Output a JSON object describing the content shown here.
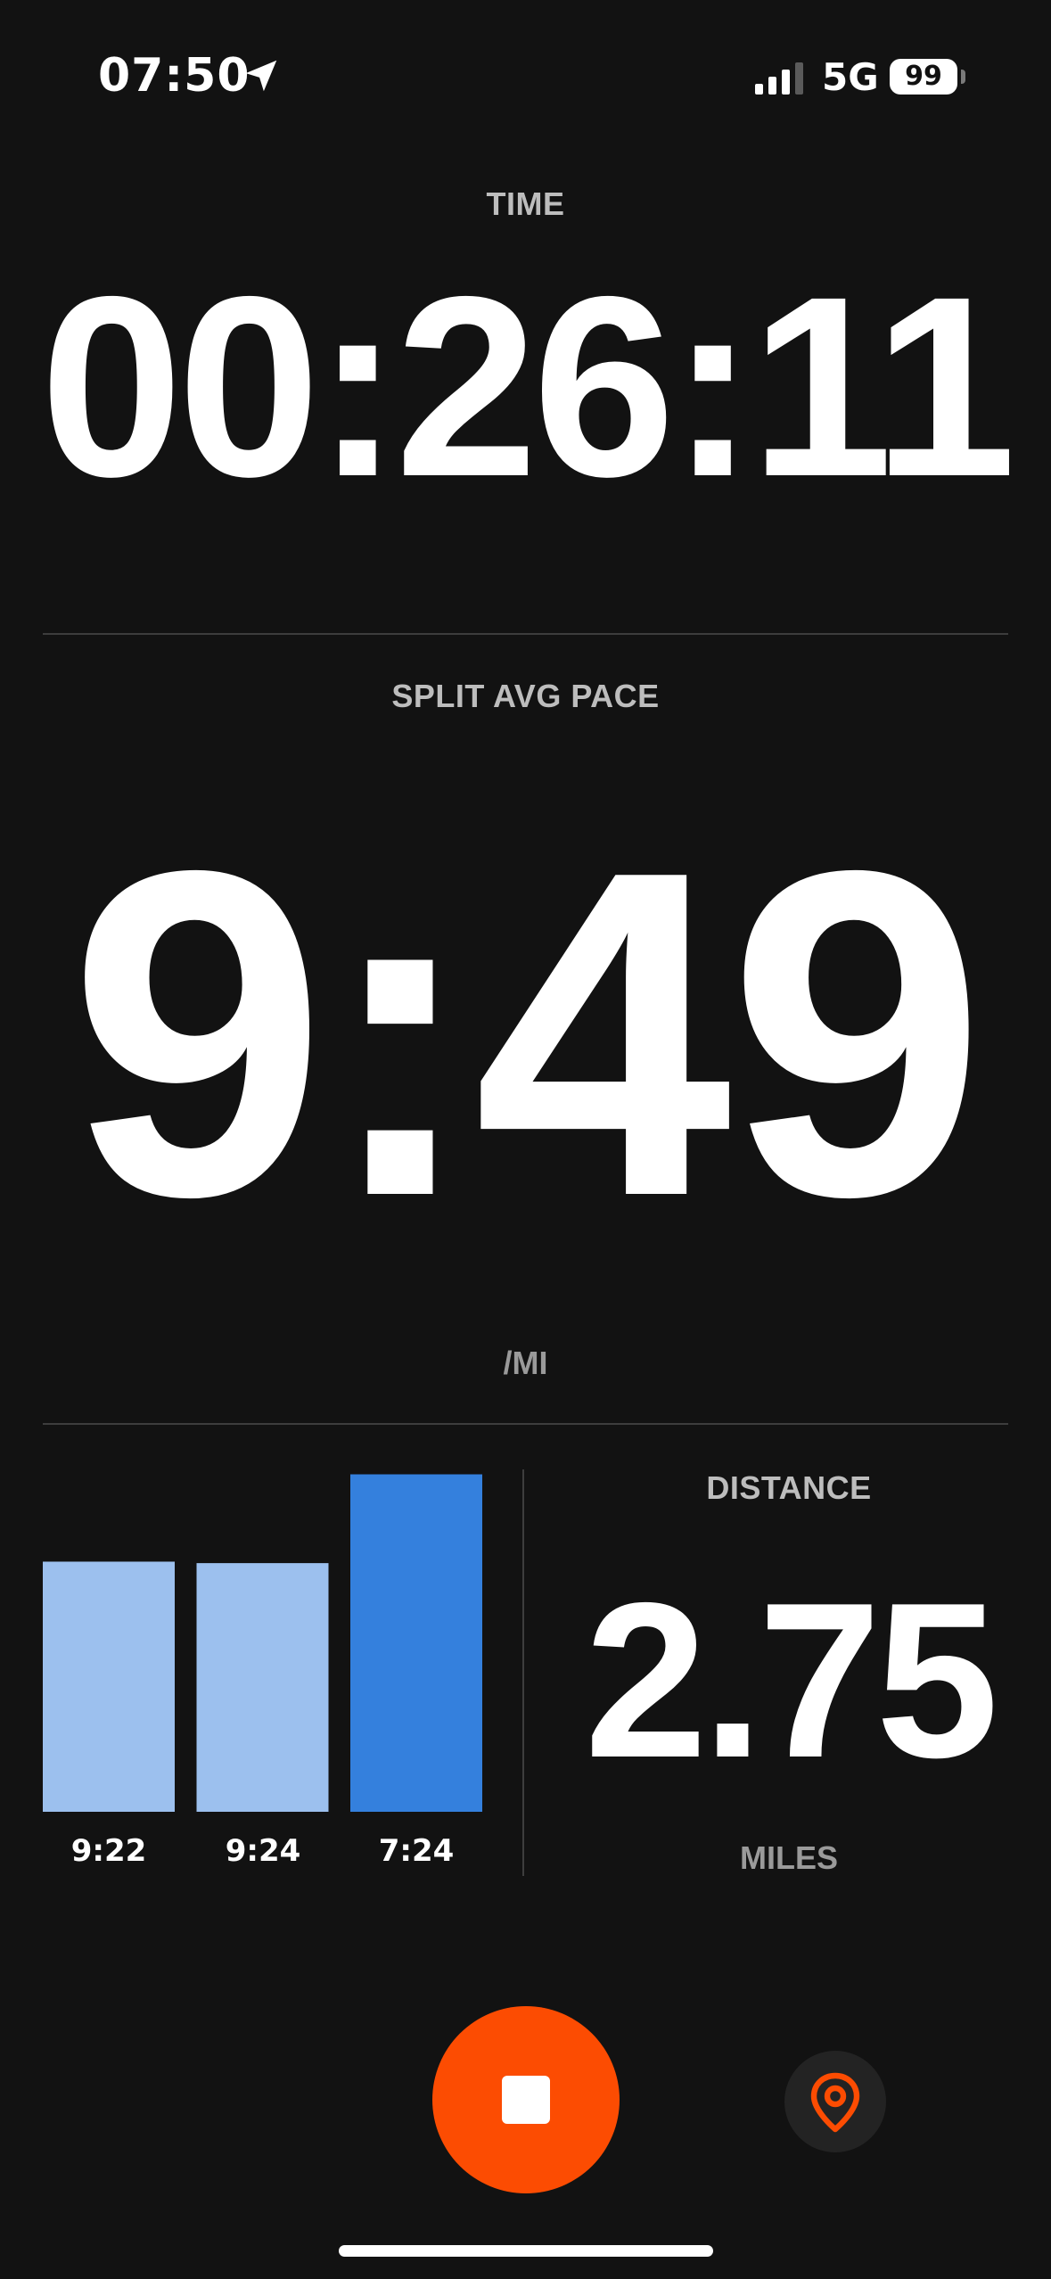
{
  "status_bar": {
    "time": "07:50",
    "network": "5G",
    "battery": "99",
    "icons": [
      "location-arrow-icon",
      "signal-icon",
      "battery-icon"
    ]
  },
  "time_section": {
    "label": "TIME",
    "value": "00:26:11"
  },
  "pace_section": {
    "label": "SPLIT AVG PACE",
    "value": "9:49",
    "unit": "/MI"
  },
  "distance_section": {
    "label": "DISTANCE",
    "value": "2.75",
    "unit": "MILES"
  },
  "chart_data": {
    "type": "bar",
    "categories": [
      "9:22",
      "9:24",
      "7:24"
    ],
    "values": [
      562,
      564,
      444
    ],
    "value_unit": "seconds per mile",
    "colors": [
      "#9cc0ee",
      "#9cc0ee",
      "#3480dd"
    ]
  },
  "controls": {
    "stop_icon": "stop-icon",
    "map_icon": "map-pin-icon",
    "stop_color": "#fc4c02",
    "map_color": "#fc4c02"
  },
  "colors": {
    "background": "#121212",
    "label": "#bdbdbd",
    "divider": "#3d3d3d"
  }
}
